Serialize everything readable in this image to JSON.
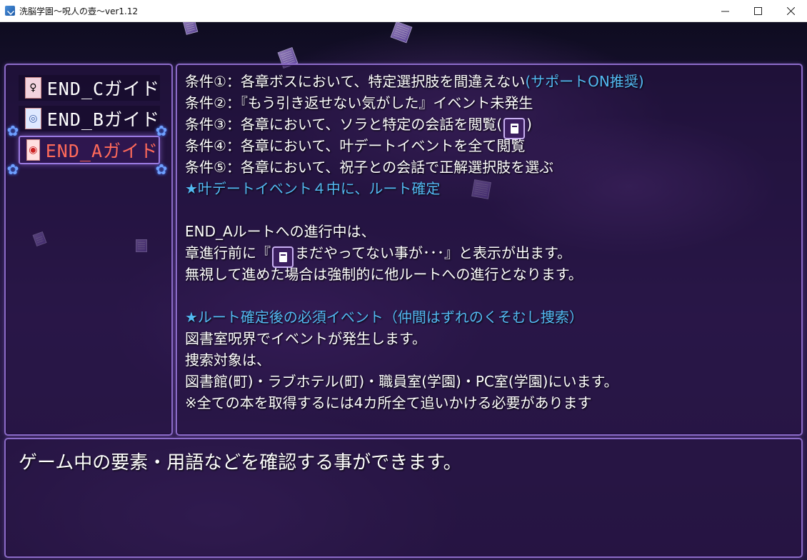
{
  "window": {
    "title": "洗脳学園～呪人の壺～ver1.12"
  },
  "menu": {
    "items": [
      {
        "label": "END_Cガイド",
        "icon": "portrait-c-icon",
        "selected": false
      },
      {
        "label": "END_Bガイド",
        "icon": "portrait-b-icon",
        "selected": false
      },
      {
        "label": "END_Aガイド",
        "icon": "portrait-a-icon",
        "selected": true
      }
    ]
  },
  "content": {
    "condition1_main": "条件①：各章ボスにおいて、特定選択肢を間違えない",
    "condition1_note": "(サポートON推奨)",
    "condition2": "条件②：『もう引き返せない気がした』イベント未発生",
    "condition3_a": "条件③：各章において、ソラと特定の会話を閲覧(",
    "condition3_b": ")",
    "condition4": "条件④：各章において、叶デートイベントを全て閲覧",
    "condition5": "条件⑤：各章において、祝子との会話で正解選択肢を選ぶ",
    "route_fix": "★叶デートイベント４中に、ルート確定",
    "progress_intro": "END_Aルートへの進行中は、",
    "warning_a": "章進行前に『",
    "warning_b": "まだやってない事が･･･』と表示が出ます。",
    "ignore_note": "無視して進めた場合は強制的に他ルートへの進行となります。",
    "required_heading": "★ルート確定後の必須イベント（仲間はずれのくそむし捜索）",
    "event_place": "図書室呪界でイベントが発生します。",
    "search_targets_label": "捜索対象は、",
    "search_targets": "図書館(町)・ラブホテル(町)・職員室(学園)・PC室(学園)にいます。",
    "all_books_note": "※全ての本を取得するには4カ所全て追いかける必要があります"
  },
  "help": {
    "text": "ゲーム中の要素・用語などを確認する事ができます。"
  },
  "colors": {
    "accent_text": "#53b9f2",
    "selected_label": "#ff6a5a",
    "panel_border": "#8c6cc8"
  }
}
